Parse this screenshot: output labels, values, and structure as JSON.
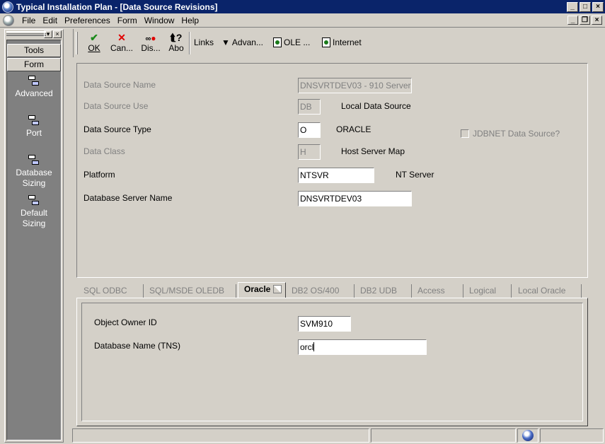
{
  "window": {
    "title": "Typical Installation Plan - [Data Source Revisions]",
    "buttons": {
      "minimize": "_",
      "maximize": "□",
      "close": "×"
    }
  },
  "menu": {
    "items": [
      "File",
      "Edit",
      "Preferences",
      "Form",
      "Window",
      "Help"
    ],
    "mdi_buttons": {
      "minimize": "_",
      "restore": "❐",
      "close": "×"
    }
  },
  "sidebar": {
    "tabs": {
      "tools": "Tools",
      "form": "Form"
    },
    "items": [
      "Advanced",
      "Port",
      "Database Sizing",
      "Default Sizing"
    ]
  },
  "toolbar": {
    "buttons": [
      {
        "label": "OK",
        "icon": "check-icon",
        "color": "#1a8a1a"
      },
      {
        "label": "Can...",
        "icon": "cancel-x-icon",
        "color": "#e00000"
      },
      {
        "label": "Dis...",
        "icon": "display-icon",
        "color": "#e00000"
      },
      {
        "label": "Abo",
        "icon": "help-pointer-icon",
        "color": "#000000"
      }
    ],
    "links_label": "Links",
    "advanced_label": "Advan...",
    "ole_label": "OLE ...",
    "internet_label": "Internet"
  },
  "form": {
    "data_source_name": {
      "label": "Data Source Name",
      "value": "DNSVRTDEV03 - 910 Server"
    },
    "data_source_use": {
      "label": "Data Source Use",
      "value": "DB",
      "description": "Local Data Source"
    },
    "data_source_type": {
      "label": "Data Source Type",
      "value": "O",
      "description": "ORACLE"
    },
    "jdbnet": {
      "label": "JDBNET Data Source?"
    },
    "data_class": {
      "label": "Data Class",
      "value": "H",
      "description": "Host Server Map"
    },
    "platform": {
      "label": "Platform",
      "value": "NTSVR",
      "description": "NT Server"
    },
    "database_server_name": {
      "label": "Database Server Name",
      "value": "DNSVRTDEV03"
    }
  },
  "tabs": [
    "SQL ODBC",
    "SQL/MSDE OLEDB",
    "Oracle",
    "DB2 OS/400",
    "DB2 UDB",
    "Access",
    "Logical",
    "Local Oracle"
  ],
  "oracle_tab": {
    "object_owner_id": {
      "label": "Object Owner ID",
      "value": "SVM910"
    },
    "database_name": {
      "label": "Database Name (TNS)",
      "value": "orcl"
    }
  }
}
